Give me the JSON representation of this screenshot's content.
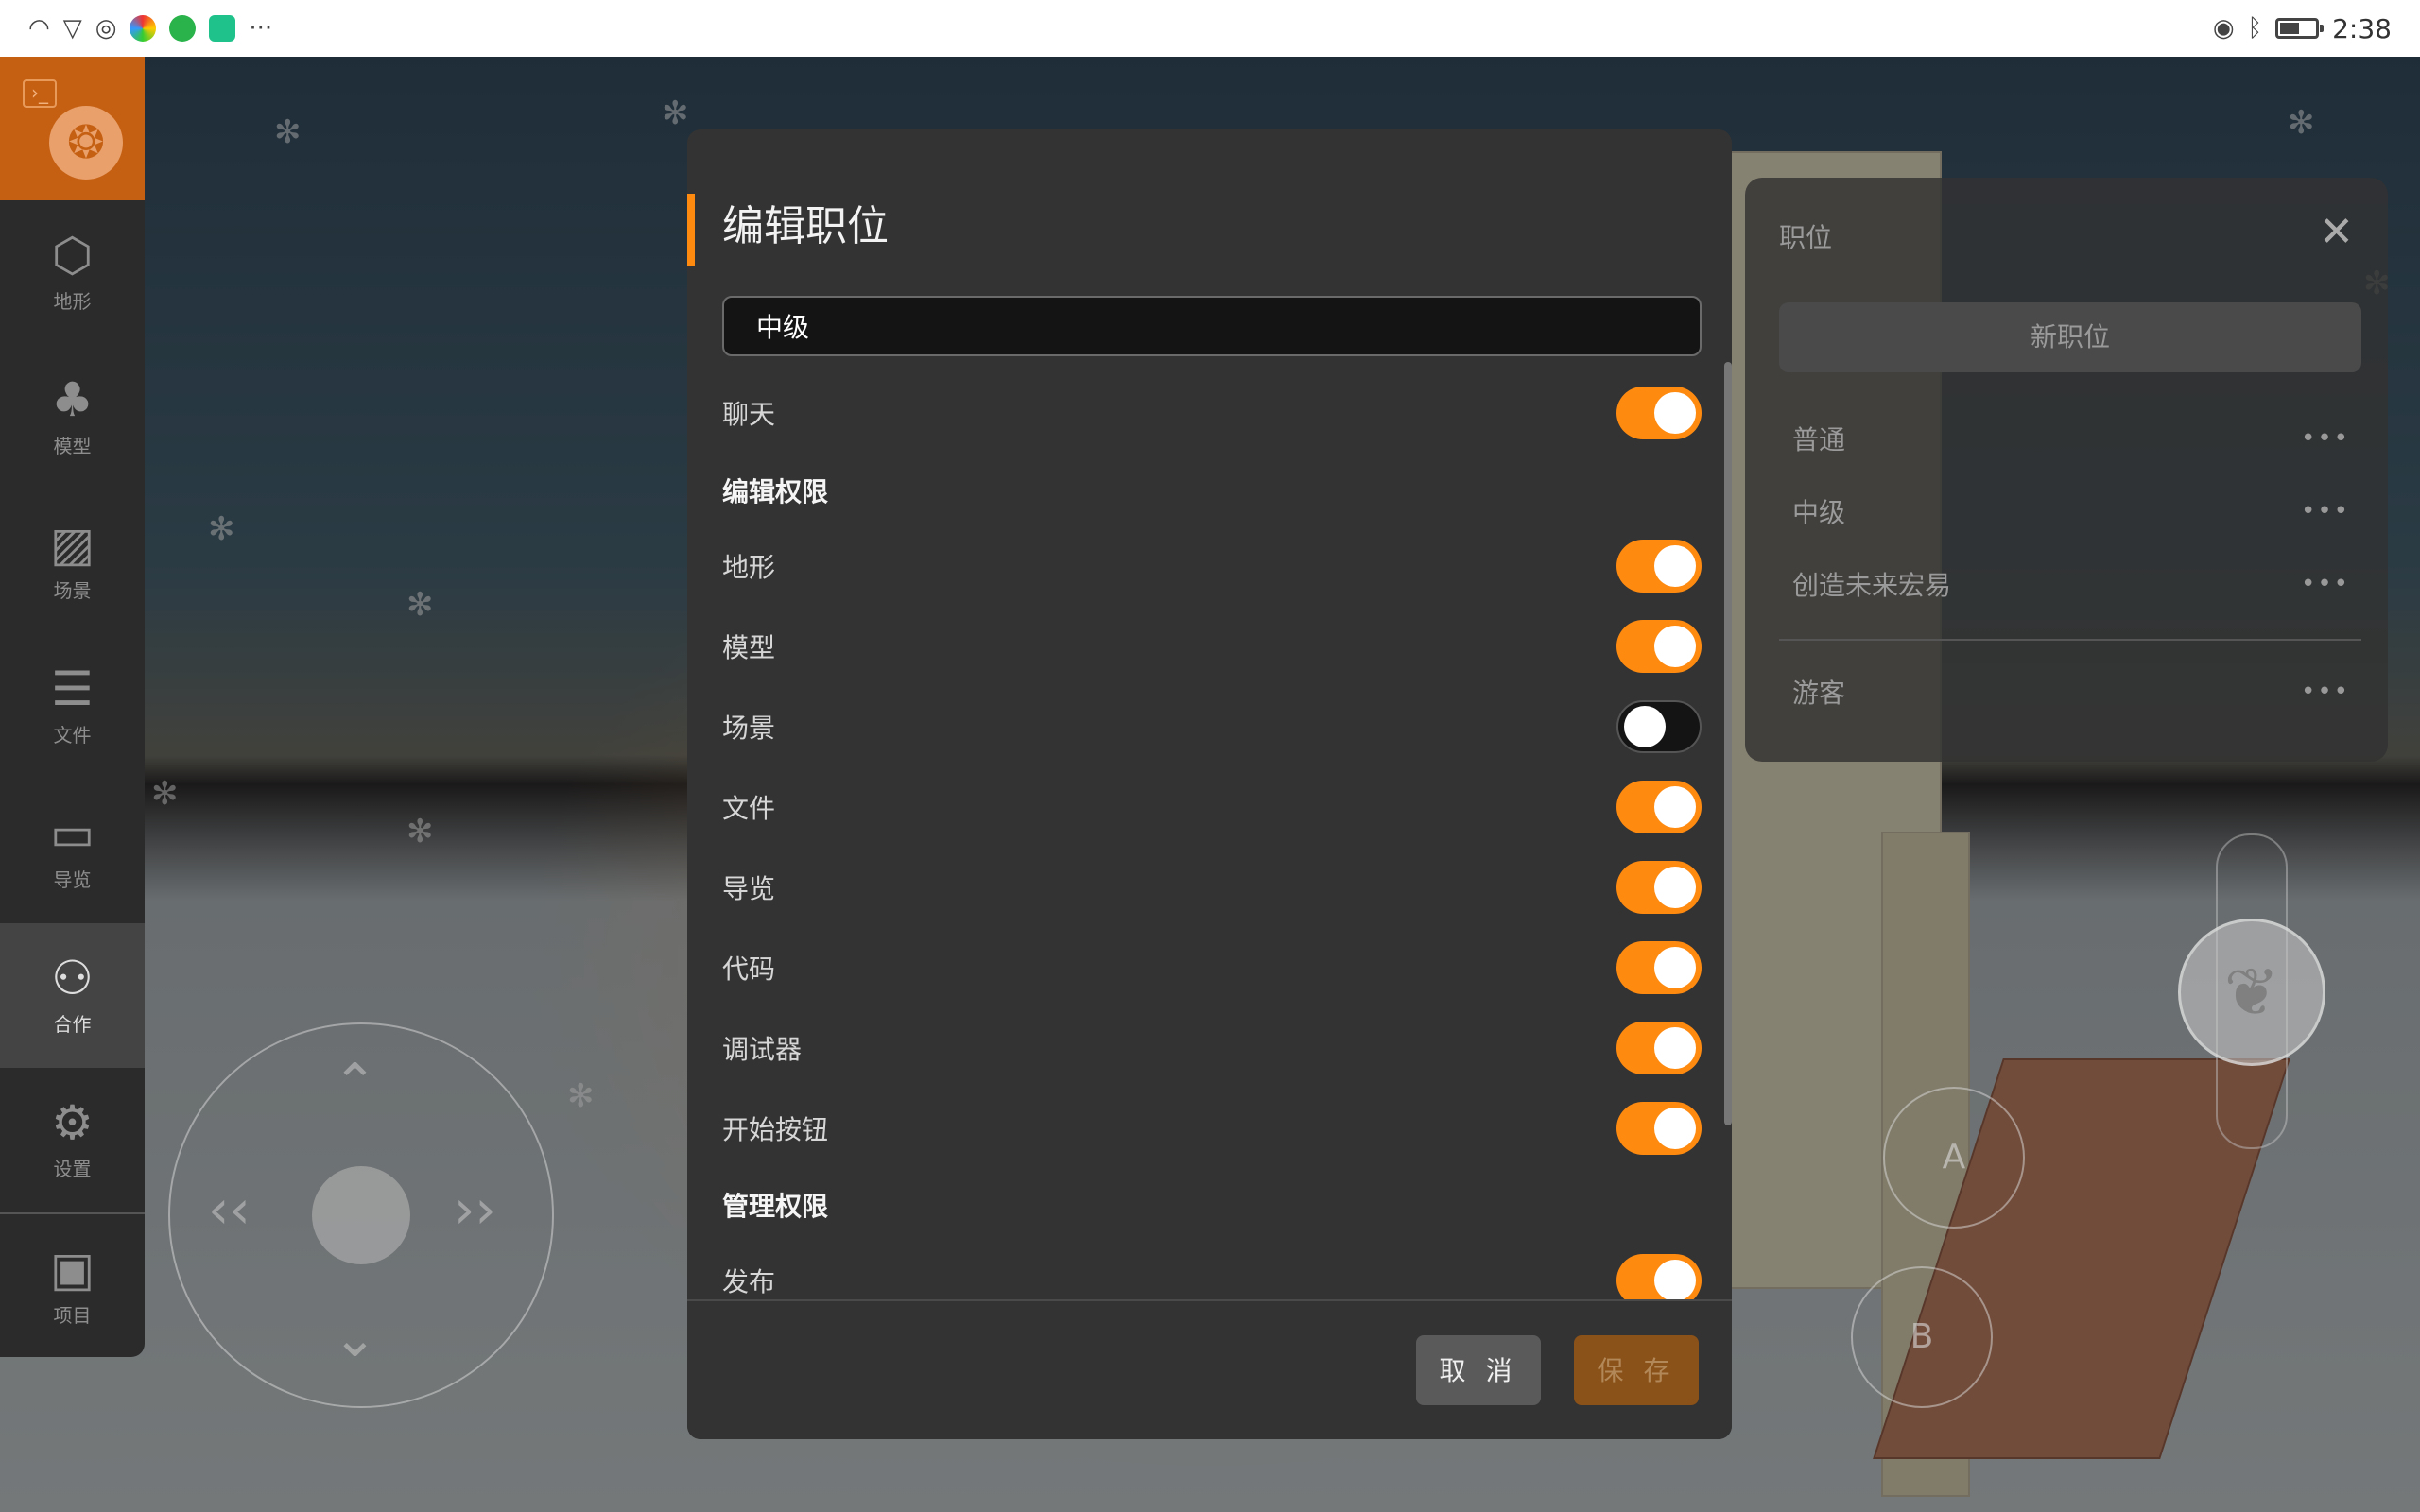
{
  "status_bar": {
    "time": "2:38",
    "battery_level": 0.55,
    "left_icons": [
      "wifi-icon",
      "shield-icon",
      "sync-icon",
      "app-icon-colorful",
      "app-icon-green",
      "app-icon-shield"
    ],
    "more": "···",
    "right_icons": [
      "eye-icon",
      "bluetooth-icon",
      "battery-icon"
    ]
  },
  "sidebar": {
    "items": [
      {
        "label": "地形",
        "icon": "cube-icon",
        "glyph": "⬡"
      },
      {
        "label": "模型",
        "icon": "tree-icon",
        "glyph": "♣"
      },
      {
        "label": "场景",
        "icon": "image-icon",
        "glyph": "▨"
      },
      {
        "label": "文件",
        "icon": "file-list-icon",
        "glyph": "☰"
      },
      {
        "label": "导览",
        "icon": "folder-icon",
        "glyph": "▭"
      },
      {
        "label": "合作",
        "icon": "users-icon",
        "glyph": "⚇",
        "active": true
      },
      {
        "label": "设置",
        "icon": "gear-icon",
        "glyph": "⚙"
      },
      {
        "label": "项目",
        "icon": "project-avatar-icon",
        "glyph": "▣"
      }
    ]
  },
  "modal": {
    "title": "编辑职位",
    "name_value": "中级",
    "permissions": [
      {
        "label": "聊天",
        "on": true
      }
    ],
    "section_edit": "编辑权限",
    "edit_permissions": [
      {
        "label": "地形",
        "on": true
      },
      {
        "label": "模型",
        "on": true
      },
      {
        "label": "场景",
        "on": false
      },
      {
        "label": "文件",
        "on": true
      },
      {
        "label": "导览",
        "on": true
      },
      {
        "label": "代码",
        "on": true
      },
      {
        "label": "调试器",
        "on": true
      },
      {
        "label": "开始按钮",
        "on": true
      }
    ],
    "section_manage": "管理权限",
    "manage_permissions": [
      {
        "label": "发布",
        "on": true
      }
    ],
    "cancel_label": "取 消",
    "save_label": "保 存"
  },
  "roles_panel": {
    "title": "职位",
    "new_label": "新职位",
    "roles": [
      "普通",
      "中级",
      "创造未来宏易"
    ],
    "guest": "游客",
    "more": "•••"
  },
  "controls": {
    "button_a": "A",
    "button_b": "B"
  },
  "colors": {
    "accent": "#ff8a10",
    "modal_bg": "#333333",
    "sidebar_active": "#c55f12"
  }
}
